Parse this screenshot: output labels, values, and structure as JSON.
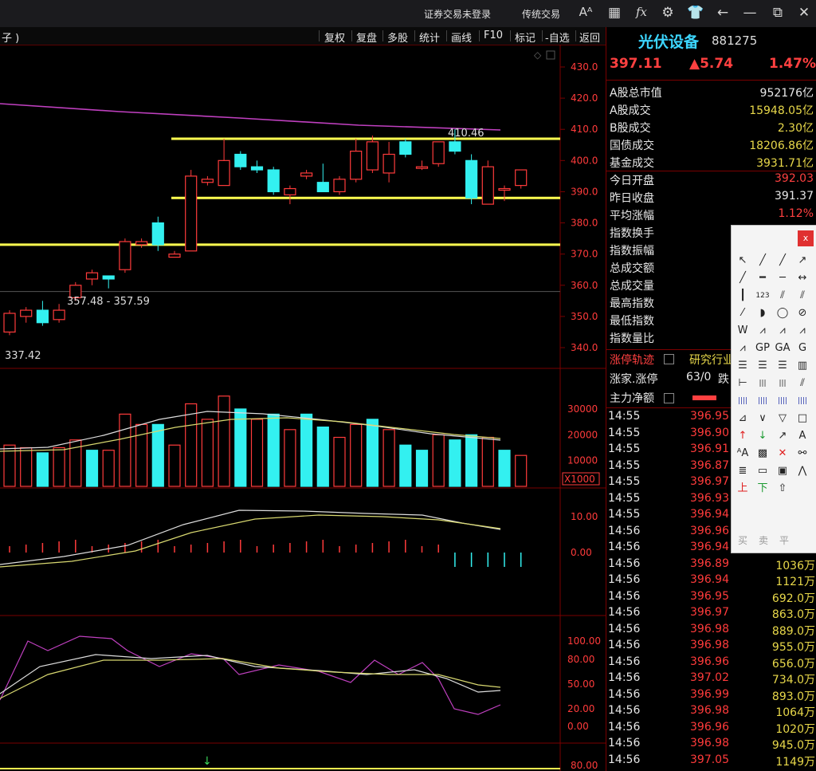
{
  "titlebar": {
    "login_status": "证券交易未登录",
    "classic_trade": "传统交易",
    "icons": [
      "font-size-icon",
      "layout-grid-icon",
      "fx-formula-icon",
      "gear-icon",
      "shirt-icon",
      "back-arrow-icon",
      "minimize-icon",
      "restore-icon",
      "close-icon"
    ],
    "icon_glyphs": [
      "Aᴬ",
      "▦",
      "fx",
      "⚙",
      "♟",
      "←",
      "—",
      "⧉",
      "✕"
    ]
  },
  "toolbar": {
    "left_label": "子 )",
    "tabs": [
      "复权",
      "复盘",
      "多股",
      "统计",
      "画线",
      "F10",
      "标记",
      "-自选",
      "返回"
    ]
  },
  "chart": {
    "price_axis_ticks": [
      "430.0",
      "420.0",
      "410.0",
      "400.0",
      "390.0",
      "380.0",
      "370.0",
      "360.0",
      "350.0",
      "340.0"
    ],
    "annotation_high": "410.46",
    "annotation_range": "357.48 - 357.59",
    "annotation_low": "337.42",
    "volume_axis_ticks": [
      "30000",
      "20000",
      "10000"
    ],
    "volume_unit": "X1000",
    "macd_axis_ticks": [
      "10.00",
      "0.00"
    ],
    "kdj_axis_ticks": [
      "100.00",
      "80.00",
      "50.00",
      "20.00",
      "0.00"
    ],
    "bottom_axis_tick": "80.00",
    "colors": {
      "up": "#ff3b3b",
      "down": "#33f0f0",
      "ma_purple": "#c040c0",
      "line_yellow": "#ffff50"
    }
  },
  "chart_data": {
    "type": "candlestick",
    "title": "光伏设备",
    "ylim": [
      335,
      432
    ],
    "candles": [
      {
        "o": 345,
        "h": 352,
        "l": 344,
        "c": 351
      },
      {
        "o": 350,
        "h": 353,
        "l": 348,
        "c": 352
      },
      {
        "o": 352,
        "h": 355,
        "l": 347,
        "c": 348
      },
      {
        "o": 349,
        "h": 354,
        "l": 348,
        "c": 352
      },
      {
        "o": 356,
        "h": 361,
        "l": 355,
        "c": 360
      },
      {
        "o": 362,
        "h": 365,
        "l": 360,
        "c": 364
      },
      {
        "o": 363,
        "h": 362,
        "l": 359,
        "c": 362
      },
      {
        "o": 365,
        "h": 375,
        "l": 364,
        "c": 374
      },
      {
        "o": 373,
        "h": 375,
        "l": 372,
        "c": 374
      },
      {
        "o": 380,
        "h": 382,
        "l": 371,
        "c": 373
      },
      {
        "o": 369,
        "h": 371,
        "l": 369,
        "c": 370
      },
      {
        "o": 371,
        "h": 397,
        "l": 371,
        "c": 395
      },
      {
        "o": 393,
        "h": 395,
        "l": 392,
        "c": 394
      },
      {
        "o": 392,
        "h": 407,
        "l": 392,
        "c": 400
      },
      {
        "o": 402,
        "h": 403,
        "l": 397,
        "c": 398
      },
      {
        "o": 398,
        "h": 400,
        "l": 396,
        "c": 397
      },
      {
        "o": 397,
        "h": 398,
        "l": 389,
        "c": 390
      },
      {
        "o": 389,
        "h": 392,
        "l": 386,
        "c": 391
      },
      {
        "o": 395,
        "h": 397,
        "l": 394,
        "c": 396
      },
      {
        "o": 393,
        "h": 399,
        "l": 391,
        "c": 390
      },
      {
        "o": 390,
        "h": 395,
        "l": 389,
        "c": 394
      },
      {
        "o": 394,
        "h": 407,
        "l": 393,
        "c": 403
      },
      {
        "o": 397,
        "h": 408,
        "l": 396,
        "c": 406
      },
      {
        "o": 396,
        "h": 406,
        "l": 393,
        "c": 402
      },
      {
        "o": 406,
        "h": 407,
        "l": 401,
        "c": 402
      },
      {
        "o": 398,
        "h": 400,
        "l": 397,
        "c": 398
      },
      {
        "o": 399,
        "h": 406,
        "l": 398,
        "c": 406
      },
      {
        "o": 406,
        "h": 410,
        "l": 402,
        "c": 403
      },
      {
        "o": 400,
        "h": 402,
        "l": 386,
        "c": 388
      },
      {
        "o": 386,
        "h": 400,
        "l": 386,
        "c": 398
      },
      {
        "o": 391,
        "h": 392,
        "l": 387,
        "c": 391
      },
      {
        "o": 392,
        "h": 397,
        "l": 391,
        "c": 397
      }
    ],
    "support_lines": [
      407,
      388,
      373
    ],
    "volume": [
      {
        "v": 16000,
        "up": true
      },
      {
        "v": 15000,
        "up": true
      },
      {
        "v": 13000,
        "up": false
      },
      {
        "v": 15000,
        "up": true
      },
      {
        "v": 18000,
        "up": true
      },
      {
        "v": 14000,
        "up": false
      },
      {
        "v": 14000,
        "up": true
      },
      {
        "v": 28000,
        "up": true
      },
      {
        "v": 24000,
        "up": true
      },
      {
        "v": 24000,
        "up": false
      },
      {
        "v": 16000,
        "up": true
      },
      {
        "v": 32000,
        "up": true
      },
      {
        "v": 26000,
        "up": true
      },
      {
        "v": 35000,
        "up": true
      },
      {
        "v": 30000,
        "up": false
      },
      {
        "v": 26000,
        "up": true
      },
      {
        "v": 28000,
        "up": false
      },
      {
        "v": 22000,
        "up": true
      },
      {
        "v": 28000,
        "up": false
      },
      {
        "v": 23000,
        "up": false
      },
      {
        "v": 19000,
        "up": true
      },
      {
        "v": 24000,
        "up": true
      },
      {
        "v": 26000,
        "up": false
      },
      {
        "v": 22000,
        "up": true
      },
      {
        "v": 16000,
        "up": false
      },
      {
        "v": 14000,
        "up": false
      },
      {
        "v": 20000,
        "up": true
      },
      {
        "v": 18000,
        "up": false
      },
      {
        "v": 20000,
        "up": false
      },
      {
        "v": 19000,
        "up": true
      },
      {
        "v": 14000,
        "up": false
      },
      {
        "v": 12000,
        "up": true
      }
    ]
  },
  "panel": {
    "name": "光伏设备",
    "code": "881275",
    "price": "397.11",
    "change": "▲5.74",
    "change_pct": "1.47%",
    "stats": [
      {
        "label": "A股总市值",
        "value": "952176亿",
        "color": "white"
      },
      {
        "label": "A股成交",
        "value": "15948.05亿",
        "color": "yellow"
      },
      {
        "label": "B股成交",
        "value": "2.30亿",
        "color": "yellow"
      },
      {
        "label": "国债成交",
        "value": "18206.86亿",
        "color": "yellow"
      },
      {
        "label": "基金成交",
        "value": "3931.71亿",
        "color": "yellow"
      },
      {
        "label": "今日开盘",
        "value": "392.03",
        "color": "red"
      },
      {
        "label": "昨日收盘",
        "value": "391.37",
        "color": "white"
      },
      {
        "label": "平均涨幅",
        "value": "1.12%",
        "color": "red"
      },
      {
        "label": "指数换手",
        "value": "",
        "color": "white"
      },
      {
        "label": "指数振幅",
        "value": "",
        "color": "white"
      },
      {
        "label": "总成交额",
        "value": "",
        "color": "white"
      },
      {
        "label": "总成交量",
        "value": "",
        "color": "white"
      },
      {
        "label": "最高指数",
        "value": "",
        "color": "white"
      },
      {
        "label": "最低指数",
        "value": "",
        "color": "white"
      },
      {
        "label": "指数量比",
        "value": "",
        "color": "white"
      }
    ],
    "limit_track": "涨停轨迹",
    "research": "研究行业",
    "limit_up_label": "涨家.涨停",
    "limit_up_value": "63/0",
    "limit_down_label": "跌",
    "main_net": "主力净额",
    "ticks": [
      {
        "time": "14:55",
        "price": "396.95",
        "vol": ""
      },
      {
        "time": "14:55",
        "price": "396.90",
        "vol": ""
      },
      {
        "time": "14:55",
        "price": "396.91",
        "vol": ""
      },
      {
        "time": "14:55",
        "price": "396.87",
        "vol": ""
      },
      {
        "time": "14:55",
        "price": "396.97",
        "vol": ""
      },
      {
        "time": "14:55",
        "price": "396.93",
        "vol": ""
      },
      {
        "time": "14:55",
        "price": "396.94",
        "vol": ""
      },
      {
        "time": "14:56",
        "price": "396.96",
        "vol": ""
      },
      {
        "time": "14:56",
        "price": "396.94",
        "vol": ""
      },
      {
        "time": "14:56",
        "price": "396.89",
        "vol": "1036万"
      },
      {
        "time": "14:56",
        "price": "396.94",
        "vol": "1121万"
      },
      {
        "time": "14:56",
        "price": "396.95",
        "vol": "692.0万"
      },
      {
        "time": "14:56",
        "price": "396.97",
        "vol": "863.0万"
      },
      {
        "time": "14:56",
        "price": "396.98",
        "vol": "889.0万"
      },
      {
        "time": "14:56",
        "price": "396.98",
        "vol": "955.0万"
      },
      {
        "time": "14:56",
        "price": "396.96",
        "vol": "656.0万"
      },
      {
        "time": "14:56",
        "price": "397.02",
        "vol": "734.0万"
      },
      {
        "time": "14:56",
        "price": "396.99",
        "vol": "893.0万"
      },
      {
        "time": "14:56",
        "price": "396.98",
        "vol": "1064万"
      },
      {
        "time": "14:56",
        "price": "396.96",
        "vol": "1020万"
      },
      {
        "time": "14:56",
        "price": "396.98",
        "vol": "945.0万"
      },
      {
        "time": "14:56",
        "price": "397.05",
        "vol": "1149万"
      }
    ]
  },
  "palette": {
    "close": "x",
    "buy": "买",
    "sell": "卖",
    "flat": "平",
    "up_label": "上",
    "down_label": "下"
  }
}
